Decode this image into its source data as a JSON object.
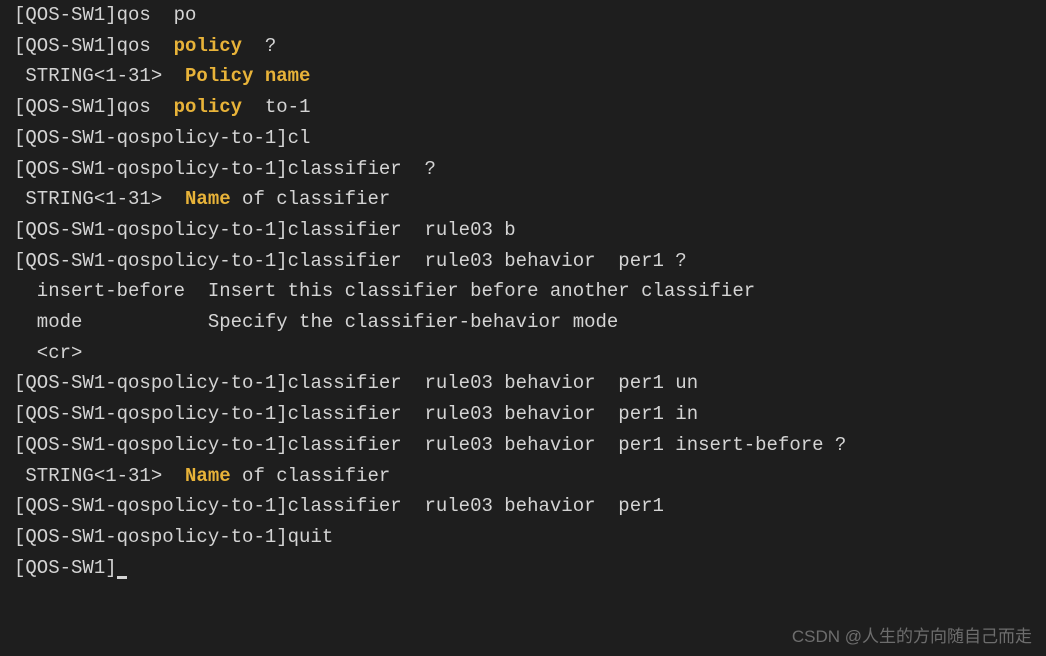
{
  "lines": [
    {
      "segments": [
        {
          "t": "[QOS-SW1]qos  po"
        }
      ]
    },
    {
      "segments": [
        {
          "t": "[QOS-SW1]qos  "
        },
        {
          "t": "policy",
          "hl": true
        },
        {
          "t": "  ?"
        }
      ]
    },
    {
      "segments": [
        {
          "t": " STRING<1-31>  "
        },
        {
          "t": "Policy name",
          "hl": true
        }
      ]
    },
    {
      "segments": [
        {
          "t": ""
        }
      ]
    },
    {
      "segments": [
        {
          "t": "[QOS-SW1]qos  "
        },
        {
          "t": "policy",
          "hl": true
        },
        {
          "t": "  to-1"
        }
      ]
    },
    {
      "segments": [
        {
          "t": "[QOS-SW1-qospolicy-to-1]cl"
        }
      ]
    },
    {
      "segments": [
        {
          "t": "[QOS-SW1-qospolicy-to-1]classifier  ?"
        }
      ]
    },
    {
      "segments": [
        {
          "t": " STRING<1-31>  "
        },
        {
          "t": "Name",
          "hl": true
        },
        {
          "t": " of classifier"
        }
      ]
    },
    {
      "segments": [
        {
          "t": ""
        }
      ]
    },
    {
      "segments": [
        {
          "t": "[QOS-SW1-qospolicy-to-1]classifier  rule03 b"
        }
      ]
    },
    {
      "segments": [
        {
          "t": "[QOS-SW1-qospolicy-to-1]classifier  rule03 behavior  per1 ?"
        }
      ]
    },
    {
      "segments": [
        {
          "t": "  insert-before  Insert this classifier before another classifier"
        }
      ]
    },
    {
      "segments": [
        {
          "t": "  mode           Specify the classifier-behavior mode"
        }
      ]
    },
    {
      "segments": [
        {
          "t": "  <cr>"
        }
      ]
    },
    {
      "segments": [
        {
          "t": ""
        }
      ]
    },
    {
      "segments": [
        {
          "t": "[QOS-SW1-qospolicy-to-1]classifier  rule03 behavior  per1 un"
        }
      ]
    },
    {
      "segments": [
        {
          "t": "[QOS-SW1-qospolicy-to-1]classifier  rule03 behavior  per1 in"
        }
      ]
    },
    {
      "segments": [
        {
          "t": "[QOS-SW1-qospolicy-to-1]classifier  rule03 behavior  per1 insert-before ?"
        }
      ]
    },
    {
      "segments": [
        {
          "t": " STRING<1-31>  "
        },
        {
          "t": "Name",
          "hl": true
        },
        {
          "t": " of classifier"
        }
      ]
    },
    {
      "segments": [
        {
          "t": ""
        }
      ]
    },
    {
      "segments": [
        {
          "t": "[QOS-SW1-qospolicy-to-1]classifier  rule03 behavior  per1"
        }
      ]
    },
    {
      "segments": [
        {
          "t": "[QOS-SW1-qospolicy-to-1]quit"
        }
      ]
    },
    {
      "segments": [
        {
          "t": "[QOS-SW1]"
        }
      ],
      "cursor": true
    }
  ],
  "watermark": "CSDN @人生的方向随自己而走"
}
